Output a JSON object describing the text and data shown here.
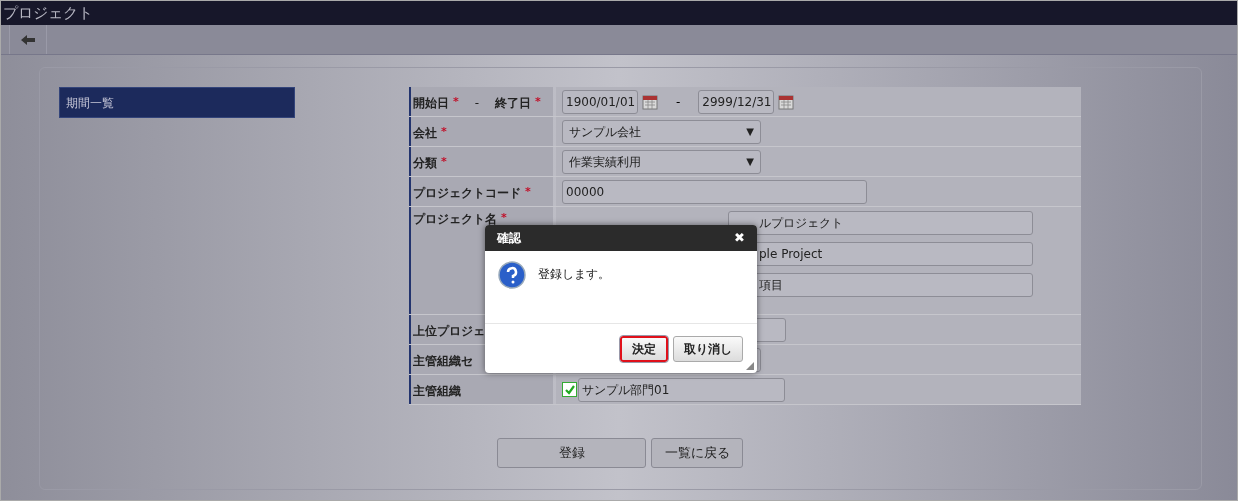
{
  "window": {
    "title": "プロジェクト"
  },
  "sidebar": {
    "items": [
      {
        "label": "期間一覧",
        "selected": true
      }
    ]
  },
  "form": {
    "rows": [
      {
        "kind": "daterange",
        "label": "開始日",
        "mark": "*",
        "label2": "終了日",
        "mark2": "*",
        "separator": "-",
        "from": "1900/01/01",
        "to": "2999/12/31",
        "label_separator": "-"
      },
      {
        "kind": "select",
        "label": "会社",
        "mark": "*",
        "value": "サンプル会社",
        "arrow": "▼"
      },
      {
        "kind": "select",
        "label": "分類",
        "mark": "*",
        "value": "作業実績利用",
        "arrow": "▼"
      },
      {
        "kind": "text",
        "label": "プロジェクトコード",
        "mark": "*",
        "value": "00000"
      },
      {
        "kind": "multi",
        "label": "プロジェクト名",
        "mark": "*",
        "values": [
          "ルプロジェクト",
          "ple Project",
          "項目"
        ]
      },
      {
        "kind": "partial_text",
        "label": "上位プロジェ"
      },
      {
        "kind": "partial_select",
        "label": "主管組織セ"
      },
      {
        "kind": "checkbox",
        "label": "主管組織",
        "checked": true,
        "value": "サンプル部門01"
      }
    ]
  },
  "buttons": [
    "登録",
    "一覧に戻る"
  ],
  "dialog": {
    "title": "確認",
    "close": "✖",
    "message": "登録します。",
    "buttons": [
      {
        "label": "決定",
        "focused": true
      },
      {
        "label": "取り消し",
        "focused": false
      }
    ]
  }
}
